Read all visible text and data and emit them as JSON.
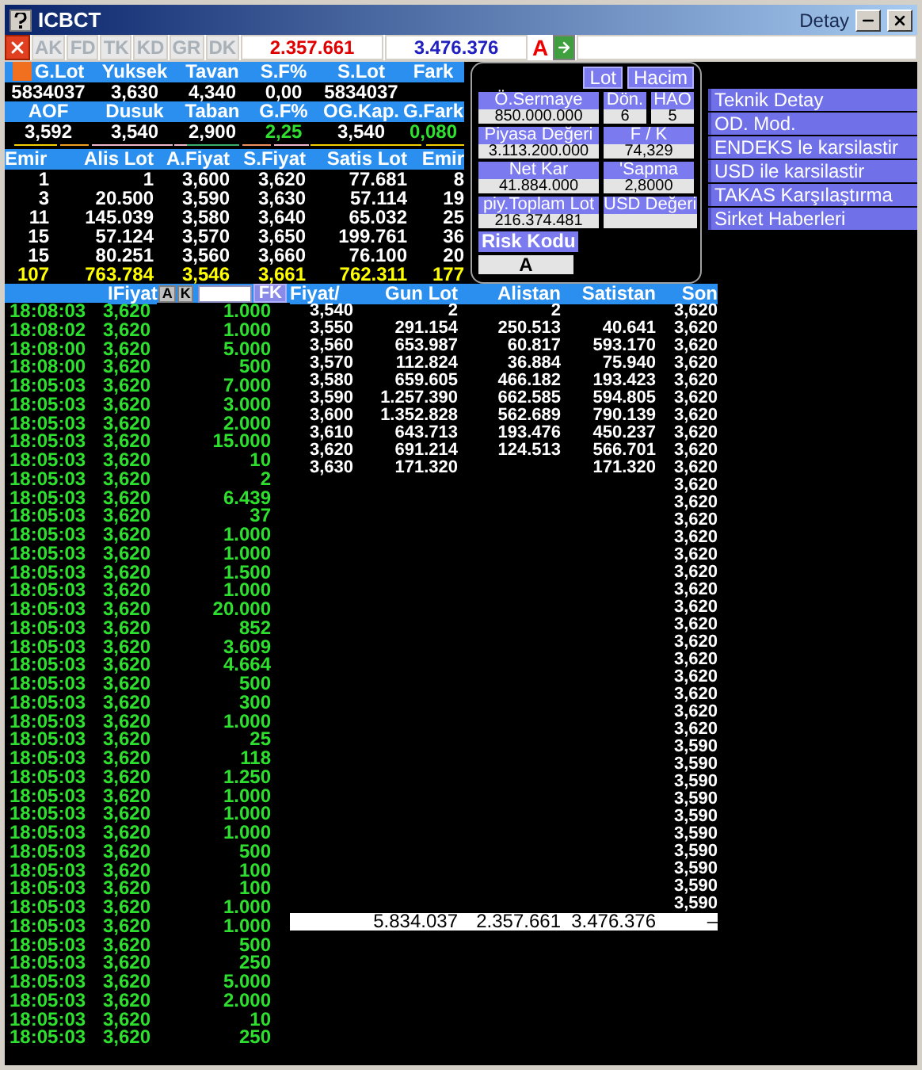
{
  "window": {
    "title": "ICBCT",
    "subtitle": "Detay"
  },
  "toolbar": {
    "tabs": [
      {
        "label": "AK",
        "disabled": true
      },
      {
        "label": "FD",
        "disabled": true
      },
      {
        "label": "TK",
        "disabled": true
      },
      {
        "label": "KD",
        "disabled": true
      },
      {
        "label": "GR",
        "disabled": true
      },
      {
        "label": "DK",
        "disabled": true
      }
    ],
    "buy_total": "2.357.661",
    "sell_total": "3.476.376",
    "mode": "A"
  },
  "summary": {
    "rows": [
      {
        "cells": [
          {
            "label": "G.Lot",
            "value": "5834037"
          },
          {
            "label": "Yuksek",
            "value": "3,630"
          },
          {
            "label": "Tavan",
            "value": "4,340"
          },
          {
            "label": "S.F%",
            "value": "0,00"
          },
          {
            "label": "S.Lot",
            "value": "5834037"
          },
          {
            "label": "Fark"
          }
        ]
      },
      {
        "cells": [
          {
            "label": "AOF",
            "value": "3,592"
          },
          {
            "label": "Dusuk",
            "value": "3,540"
          },
          {
            "label": "Taban",
            "value": "2,900"
          },
          {
            "label": "G.F%",
            "value": "2,25",
            "up": true
          },
          {
            "label": "OG.Kap.",
            "value": "3,540"
          },
          {
            "label": "G.Fark",
            "value": "0,080",
            "up": true
          }
        ]
      }
    ]
  },
  "depth": {
    "columns": [
      "Emir",
      "Alis Lot",
      "A.Fiyat",
      "S.Fiyat",
      "Satis Lot",
      "Emir"
    ],
    "rows": [
      {
        "kind": "level",
        "cells": [
          "1",
          "1",
          "3,600",
          "3,620",
          "77.681",
          "8"
        ]
      },
      {
        "kind": "level",
        "cells": [
          "3",
          "20.500",
          "3,590",
          "3,630",
          "57.114",
          "19"
        ]
      },
      {
        "kind": "level",
        "cells": [
          "11",
          "145.039",
          "3,580",
          "3,640",
          "65.032",
          "25"
        ]
      },
      {
        "kind": "level",
        "cells": [
          "15",
          "57.124",
          "3,570",
          "3,650",
          "199.761",
          "36"
        ]
      },
      {
        "kind": "level",
        "cells": [
          "15",
          "80.251",
          "3,560",
          "3,660",
          "76.100",
          "20"
        ]
      },
      {
        "kind": "total",
        "cells": [
          "107",
          "763.784",
          "3,546",
          "3,661",
          "762.311",
          "177"
        ]
      }
    ]
  },
  "info_panel": {
    "buttons": [
      "Lot",
      "Hacim"
    ],
    "rows": [
      [
        {
          "label": "Ö.Sermaye",
          "value": "850.000.000"
        },
        {
          "label": "Dön.",
          "value": "6"
        },
        {
          "label": "HAO",
          "value": "5"
        }
      ],
      [
        {
          "label": "Piyasa Değeri",
          "value": "3.113.200.000"
        },
        {
          "label": "F / K",
          "value": "74,329"
        }
      ],
      [
        {
          "label": "Net Kar",
          "value": "41.884.000"
        },
        {
          "label": "'Sapma",
          "value": "2,8000"
        }
      ],
      [
        {
          "label": "piy.Toplam Lot",
          "value": "216.374.481"
        },
        {
          "label": "USD Değeri"
        }
      ]
    ],
    "risk": {
      "label": "Risk Kodu",
      "value": "A"
    }
  },
  "menu": [
    "Teknik Detay",
    "OD. Mod.",
    "ENDEKS le karsilastir",
    "USD ile karsilastir",
    "TAKAS Karşılaştırma",
    "Sirket Haberleri"
  ],
  "trades": {
    "header": "IFiyat",
    "buttons": [
      "A",
      "K"
    ],
    "filter_button": "FK",
    "rows": [
      [
        "18:08:03",
        "3,620",
        "1.000"
      ],
      [
        "18:08:02",
        "3,620",
        "1.000"
      ],
      [
        "18:08:00",
        "3,620",
        "5.000"
      ],
      [
        "18:08:00",
        "3,620",
        "500"
      ],
      [
        "18:05:03",
        "3,620",
        "7.000"
      ],
      [
        "18:05:03",
        "3,620",
        "3.000"
      ],
      [
        "18:05:03",
        "3,620",
        "2.000"
      ],
      [
        "18:05:03",
        "3,620",
        "15.000"
      ],
      [
        "18:05:03",
        "3,620",
        "10"
      ],
      [
        "18:05:03",
        "3,620",
        "2"
      ],
      [
        "18:05:03",
        "3,620",
        "6.439"
      ],
      [
        "18:05:03",
        "3,620",
        "37"
      ],
      [
        "18:05:03",
        "3,620",
        "1.000"
      ],
      [
        "18:05:03",
        "3,620",
        "1.000"
      ],
      [
        "18:05:03",
        "3,620",
        "1.500"
      ],
      [
        "18:05:03",
        "3,620",
        "1.000"
      ],
      [
        "18:05:03",
        "3,620",
        "20.000"
      ],
      [
        "18:05:03",
        "3,620",
        "852"
      ],
      [
        "18:05:03",
        "3,620",
        "3.609"
      ],
      [
        "18:05:03",
        "3,620",
        "4.664"
      ],
      [
        "18:05:03",
        "3,620",
        "500"
      ],
      [
        "18:05:03",
        "3,620",
        "300"
      ],
      [
        "18:05:03",
        "3,620",
        "1.000"
      ],
      [
        "18:05:03",
        "3,620",
        "25"
      ],
      [
        "18:05:03",
        "3,620",
        "118"
      ],
      [
        "18:05:03",
        "3,620",
        "1.250"
      ],
      [
        "18:05:03",
        "3,620",
        "1.000"
      ],
      [
        "18:05:03",
        "3,620",
        "1.000"
      ],
      [
        "18:05:03",
        "3,620",
        "1.000"
      ],
      [
        "18:05:03",
        "3,620",
        "500"
      ],
      [
        "18:05:03",
        "3,620",
        "100"
      ],
      [
        "18:05:03",
        "3,620",
        "100"
      ],
      [
        "18:05:03",
        "3,620",
        "1.000"
      ],
      [
        "18:05:03",
        "3,620",
        "1.000"
      ],
      [
        "18:05:03",
        "3,620",
        "500"
      ],
      [
        "18:05:03",
        "3,620",
        "250"
      ],
      [
        "18:05:03",
        "3,620",
        "5.000"
      ],
      [
        "18:05:03",
        "3,620",
        "2.000"
      ],
      [
        "18:05:03",
        "3,620",
        "10"
      ],
      [
        "18:05:03",
        "3,620",
        "250"
      ]
    ]
  },
  "price_table": {
    "columns": [
      "Fiyat/",
      "Gun Lot",
      "Alistan",
      "Satistan",
      "Son"
    ],
    "rows": [
      [
        "3,540",
        "2",
        "2",
        ""
      ],
      [
        "3,550",
        "291.154",
        "250.513",
        "40.641"
      ],
      [
        "3,560",
        "653.987",
        "60.817",
        "593.170"
      ],
      [
        "3,570",
        "112.824",
        "36.884",
        "75.940"
      ],
      [
        "3,580",
        "659.605",
        "466.182",
        "193.423"
      ],
      [
        "3,590",
        "1.257.390",
        "662.585",
        "594.805"
      ],
      [
        "3,600",
        "1.352.828",
        "562.689",
        "790.139"
      ],
      [
        "3,610",
        "643.713",
        "193.476",
        "450.237"
      ],
      [
        "3,620",
        "691.214",
        "124.513",
        "566.701"
      ],
      [
        "3,630",
        "171.320",
        "",
        "171.320"
      ]
    ],
    "son": [
      "3,620",
      "3,620",
      "3,620",
      "3,620",
      "3,620",
      "3,620",
      "3,620",
      "3,620",
      "3,620",
      "3,620",
      "3,620",
      "3,620",
      "3,620",
      "3,620",
      "3,620",
      "3,620",
      "3,620",
      "3,620",
      "3,620",
      "3,620",
      "3,620",
      "3,620",
      "3,620",
      "3,620",
      "3,620",
      "3,590",
      "3,590",
      "3,590",
      "3,590",
      "3,590",
      "3,590",
      "3,590",
      "3,590",
      "3,590",
      "3,590"
    ],
    "totals": [
      "5.834.037",
      "2.357.661",
      "3.476.376",
      "–"
    ]
  }
}
